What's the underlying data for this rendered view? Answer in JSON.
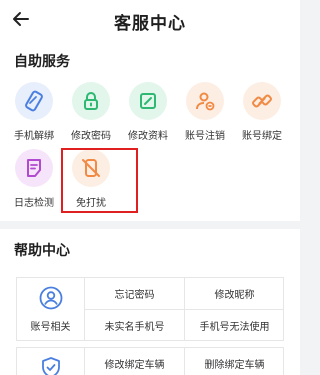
{
  "header": {
    "title": "客服中心"
  },
  "self_service": {
    "title": "自助服务",
    "items": [
      {
        "label": "手机解绑",
        "icon": "phone-unbind-icon"
      },
      {
        "label": "修改密码",
        "icon": "lock-icon"
      },
      {
        "label": "修改资料",
        "icon": "edit-profile-icon"
      },
      {
        "label": "账号注销",
        "icon": "account-cancel-icon"
      },
      {
        "label": "账号绑定",
        "icon": "link-icon"
      },
      {
        "label": "日志检测",
        "icon": "log-document-icon"
      },
      {
        "label": "免打扰",
        "icon": "do-not-disturb-icon"
      }
    ]
  },
  "help_center": {
    "title": "帮助中心",
    "categories": [
      {
        "label": "账号相关",
        "icon": "user-icon",
        "questions": [
          "忘记密码",
          "修改昵称",
          "未实名手机号",
          "手机号无法使用"
        ]
      },
      {
        "label": "",
        "icon": "shield-icon",
        "questions": [
          "修改绑定车辆",
          "删除绑定车辆"
        ]
      }
    ]
  },
  "colors": {
    "accent_blue": "#4a7fe0",
    "green": "#2eb872",
    "orange": "#f08a44",
    "purple": "#b24ad1",
    "highlight_red": "#e02020"
  }
}
